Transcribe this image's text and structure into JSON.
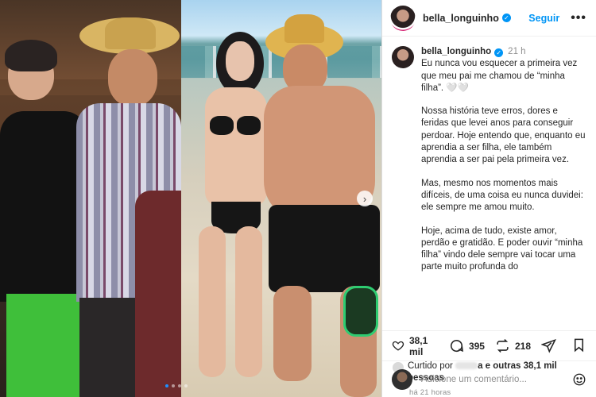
{
  "header": {
    "username": "bella_longuinho",
    "follow_label": "Seguir",
    "more_label": "•••"
  },
  "caption": {
    "username": "bella_longuinho",
    "time": "21 h",
    "paragraphs": [
      "Eu nunca vou esquecer a primeira vez que meu pai me chamou de “minha filha”. 🤍🤍",
      "Nossa história teve erros, dores e feridas que levei anos para conseguir perdoar. Hoje entendo que, enquanto eu aprendia a ser filha, ele também aprendia a ser pai pela primeira vez.",
      "Mas, mesmo nos momentos mais difíceis, de uma coisa eu nunca duvidei: ele sempre me amou muito.",
      "Hoje, acima de tudo, existe amor, perdão e gratidão. E poder ouvir “minha filha” vindo dele sempre vai tocar uma parte muito profunda do"
    ]
  },
  "actions": {
    "likes_count": "38,1 mil",
    "comments_count": "395",
    "reposts_count": "218"
  },
  "liked_by": {
    "prefix": "Curtido por",
    "suffix_a": "a e outras 38,1 mil",
    "suffix_b": "pessoas"
  },
  "timeago": "há 21 horas",
  "comment_input": {
    "placeholder": "Adicione um comentário..."
  },
  "carousel": {
    "total_dots": 4,
    "active_index": 0
  },
  "colors": {
    "accent": "#0095f6",
    "text": "#262626",
    "muted": "#8e8e8e"
  }
}
